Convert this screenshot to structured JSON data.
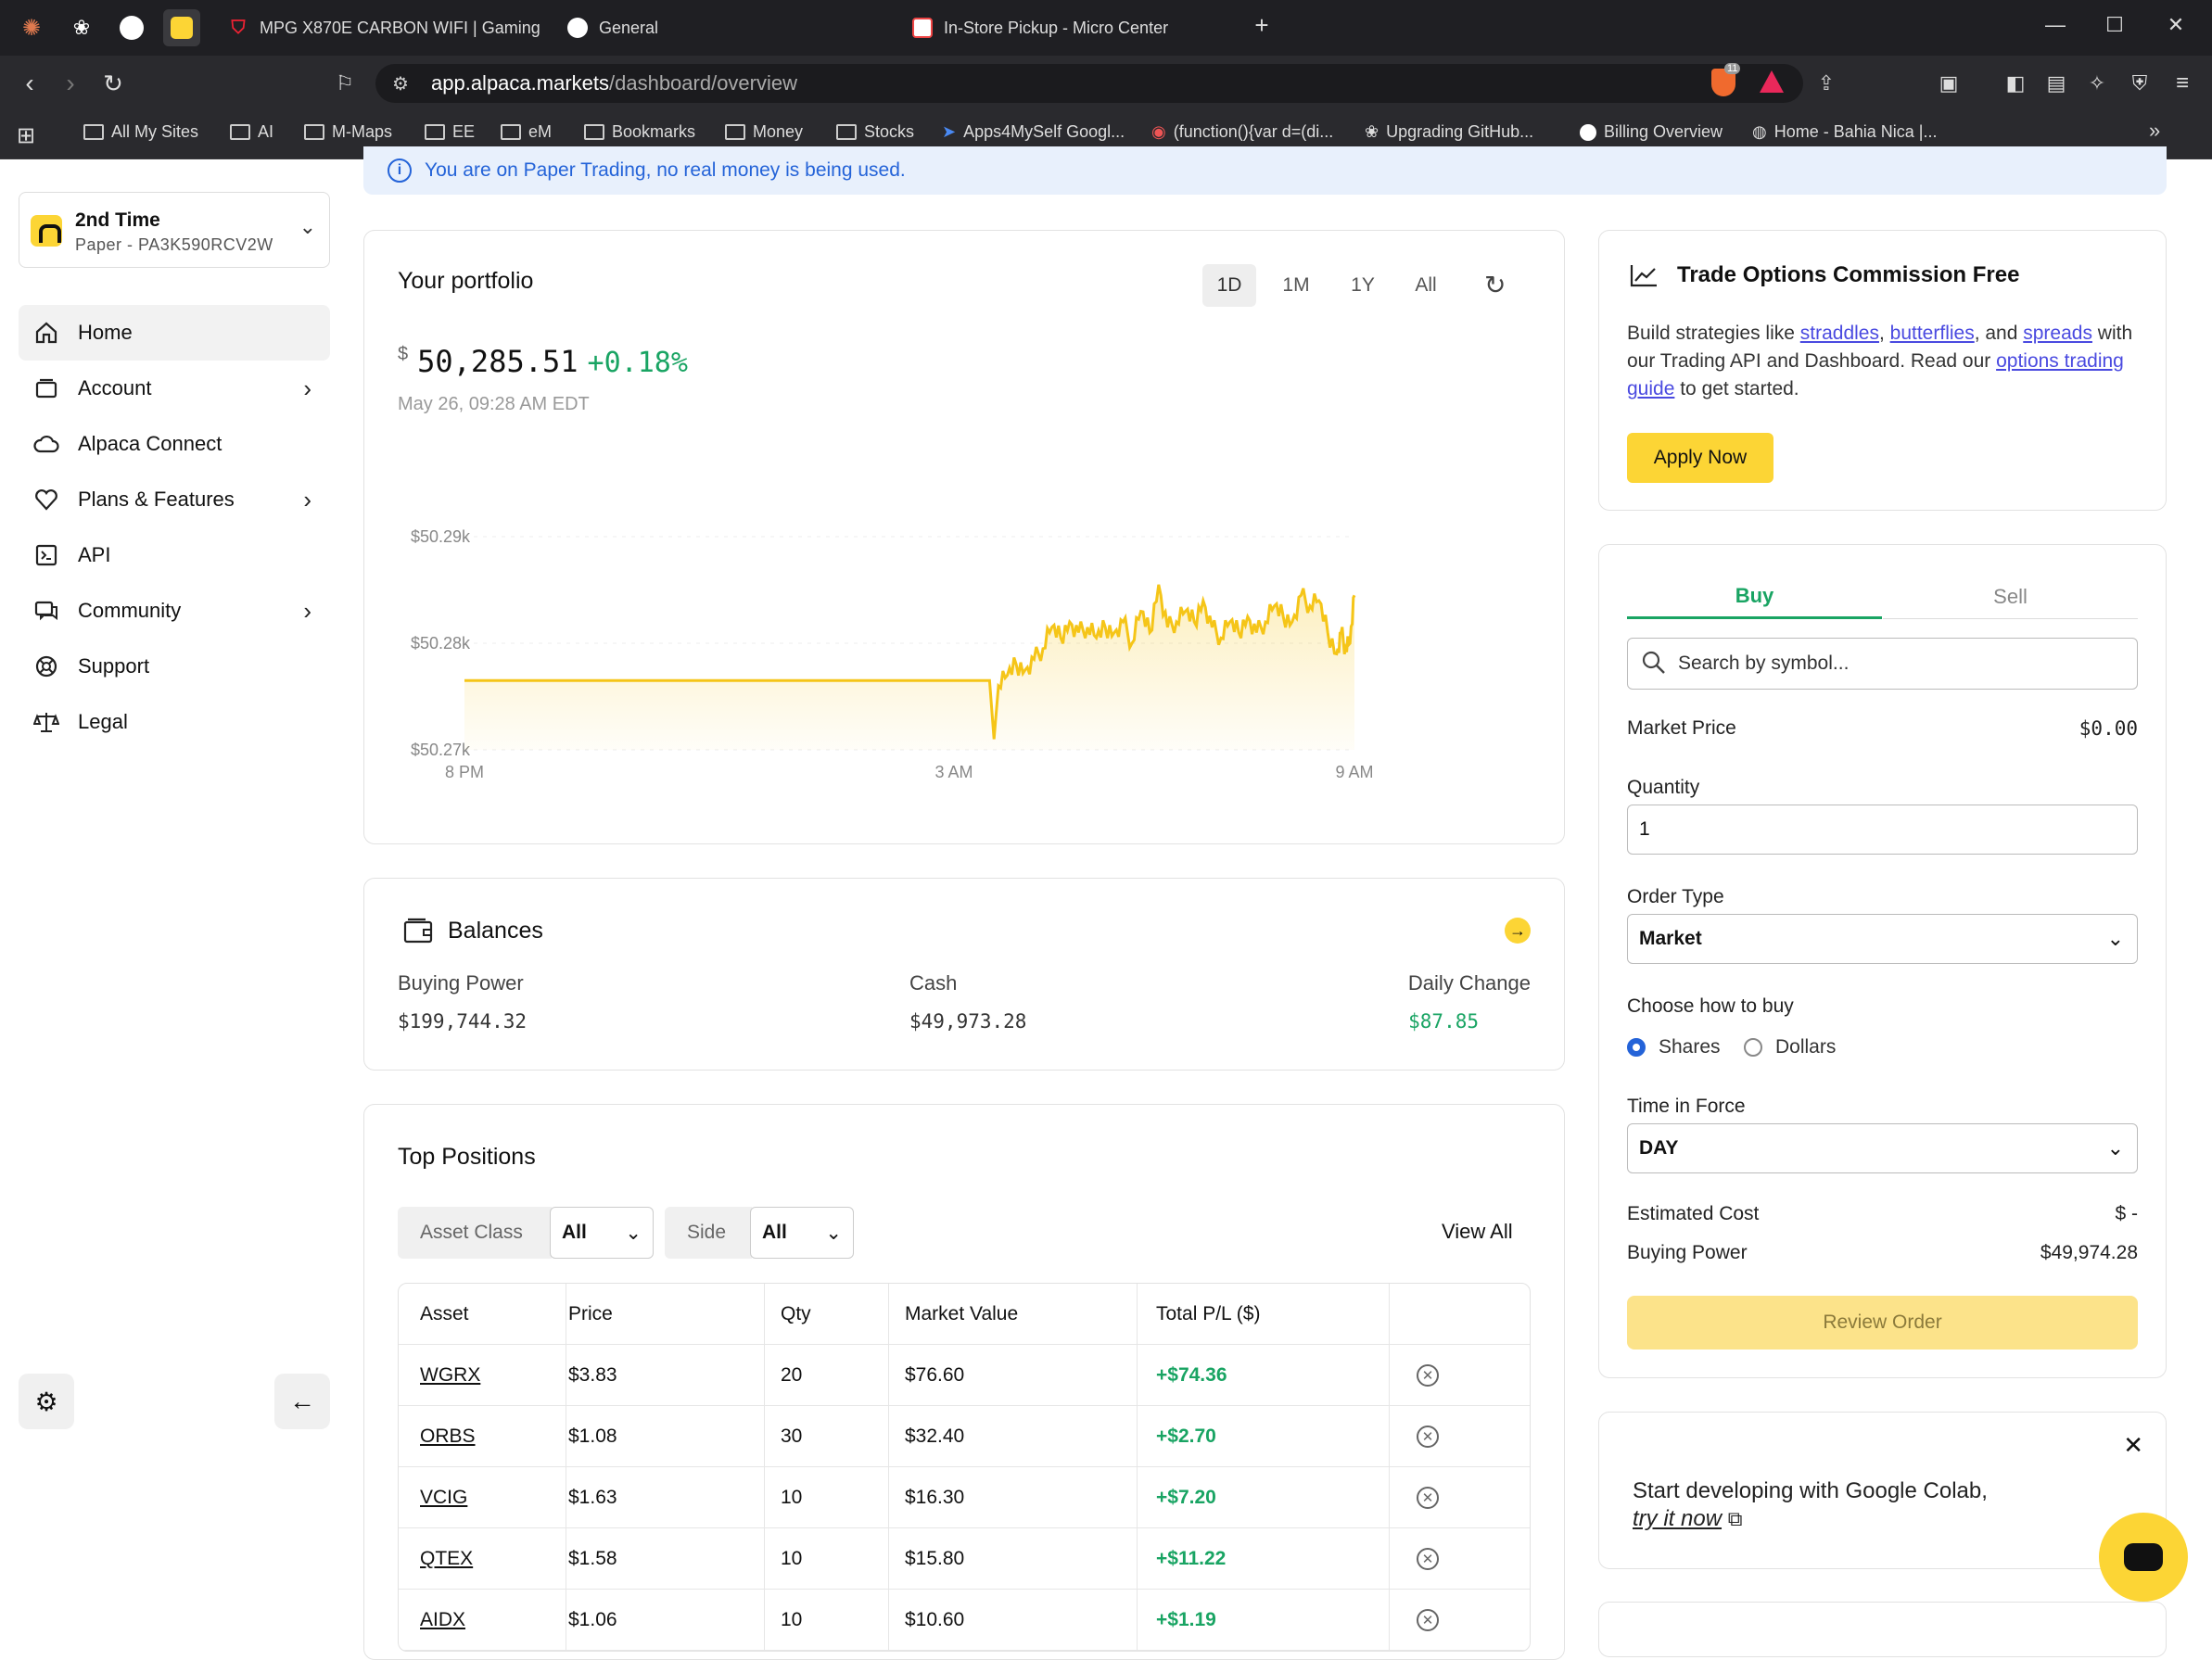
{
  "browser": {
    "tabs": [
      {
        "label": "MPG X870E CARBON WIFI | Gaming"
      },
      {
        "label": "General"
      },
      {
        "label": "In-Store Pickup - Micro Center"
      }
    ],
    "new_tab": "+",
    "url_host": "app.alpaca.markets",
    "url_path": "/dashboard/overview",
    "brave_badge": "11",
    "bookmarks": [
      "All My Sites",
      "AI",
      "M-Maps",
      "EE",
      "eM",
      "Bookmarks",
      "Money",
      "Stocks",
      "Apps4MySelf Googl...",
      "(function(){var d=(di...",
      "Upgrading GitHub...",
      "Billing Overview",
      "Home - Bahia Nica |..."
    ],
    "more": "»"
  },
  "banner": "You are on Paper Trading, no real money is being used.",
  "account": {
    "name": "2nd Time",
    "sub": "Paper - PA3K590RCV2W"
  },
  "nav": [
    {
      "label": "Home"
    },
    {
      "label": "Account"
    },
    {
      "label": "Alpaca Connect"
    },
    {
      "label": "Plans & Features"
    },
    {
      "label": "API"
    },
    {
      "label": "Community"
    },
    {
      "label": "Support"
    },
    {
      "label": "Legal"
    }
  ],
  "portfolio": {
    "title": "Your portfolio",
    "ranges": [
      "1D",
      "1M",
      "1Y",
      "All"
    ],
    "currency": "$",
    "value": "50,285.51",
    "change": "+0.18%",
    "date": "May 26, 09:28 AM EDT"
  },
  "chart_data": {
    "type": "area",
    "yticks": [
      "$50.29k",
      "$50.28k",
      "$50.27k"
    ],
    "xticks": [
      "8 PM",
      "3 AM",
      "9 AM"
    ],
    "ylim": [
      50270,
      50290
    ],
    "color": "#f5c518",
    "x": [
      0,
      1,
      2,
      3,
      4,
      5,
      6,
      7,
      8,
      9,
      10,
      11,
      12,
      13,
      14,
      15,
      16,
      17,
      18,
      19,
      20,
      21,
      22,
      23,
      24,
      25,
      26,
      27,
      28,
      29,
      30,
      31,
      32,
      33,
      34,
      35,
      36,
      37,
      38,
      39,
      40,
      41,
      42,
      43,
      44,
      45,
      46,
      47,
      48,
      49,
      50,
      51,
      52,
      53,
      54,
      55,
      56,
      57,
      58,
      59,
      60,
      61,
      62,
      63,
      64,
      65,
      66,
      67,
      68,
      69,
      70,
      71,
      72,
      73,
      74,
      75,
      76,
      77,
      78,
      79,
      80,
      81,
      82,
      83,
      84,
      85,
      86,
      87,
      88,
      89,
      90,
      91,
      92,
      93,
      94,
      95,
      96,
      97,
      98,
      99,
      100
    ],
    "y": [
      50276.0,
      50276.5,
      50276.5,
      50276.5,
      50276.5,
      50276.5,
      50276.5,
      50276.5,
      50276.5,
      50276.5,
      50276.5,
      50276.5,
      50276.5,
      50276.5,
      50276.5,
      50276.5,
      50276.5,
      50276.5,
      50276.5,
      50276.5,
      50276.5,
      50276.5,
      50276.5,
      50276.5,
      50276.5,
      50276.5,
      50276.5,
      50276.5,
      50276.5,
      50276.5,
      50276.5,
      50276.5,
      50276.5,
      50276.5,
      50276.5,
      50276.5,
      50276.5,
      50276.5,
      50276.5,
      50276.5,
      50276.5,
      50276.5,
      50276.5,
      50276.5,
      50276.5,
      50276.5,
      50276.5,
      50276.5,
      50276.5,
      50276.5,
      50276.5,
      50276.5,
      50276.5,
      50276.5,
      50276.5,
      50276.5,
      50276.5,
      50276.5,
      50276.5,
      50276.5,
      50276.5,
      50276.5,
      50276.5,
      50276.5,
      50276.5,
      50276.5,
      50276.5,
      50276.5,
      50276.5,
      50276.5,
      50276.5,
      50276.5,
      50276.5,
      50276.5,
      50276.5,
      50276.5,
      50276.5,
      50276.5,
      50276.5,
      50276.5,
      50276.5,
      50276.5,
      50276.5,
      50276.5,
      50276.5,
      50276.5,
      50276.5,
      50276.5,
      50276.5,
      50276.5,
      50276.5,
      50276.5,
      50276.5,
      50276.5,
      50276.5,
      50276.5,
      50276.5,
      50276.5,
      50276.5,
      50276.5,
      50276.5
    ]
  },
  "chart_series": {
    "x": [
      0,
      5,
      10,
      20,
      30,
      40,
      50,
      59.0,
      59.5,
      60,
      61,
      62,
      63,
      64,
      65,
      66,
      67,
      68,
      69,
      70,
      71,
      72,
      73,
      74,
      75,
      76,
      77,
      78,
      79,
      80,
      81,
      82,
      83,
      84,
      85,
      86,
      87,
      88,
      89,
      90,
      91,
      92,
      93,
      94,
      95,
      96,
      97,
      98,
      98.5,
      99,
      99.5,
      100
    ],
    "y": [
      50276.5,
      50276.5,
      50276.5,
      50276.5,
      50276.5,
      50276.5,
      50276.5,
      50276.5,
      50271.0,
      50276.0,
      50277.0,
      50278.0,
      50277.5,
      50278.5,
      50279.5,
      50281.5,
      50280.5,
      50282.0,
      50281.0,
      50281.5,
      50280.5,
      50281.5,
      50281.0,
      50282.0,
      50280.0,
      50283.0,
      50281.0,
      50285.5,
      50281.5,
      50282.0,
      50283.0,
      50282.0,
      50284.0,
      50281.5,
      50280.5,
      50282.0,
      50281.0,
      50282.5,
      50281.0,
      50282.0,
      50283.5,
      50282.5,
      50282.0,
      50284.5,
      50283.5,
      50284.0,
      50281.0,
      50279.0,
      50281.0,
      50279.5,
      50280.0,
      50284.5
    ]
  },
  "balances": {
    "title": "Balances",
    "buying_power_label": "Buying Power",
    "buying_power": "$199,744.32",
    "cash_label": "Cash",
    "cash": "$49,973.28",
    "daily_change_label": "Daily Change",
    "daily_change": "$87.85"
  },
  "positions": {
    "title": "Top Positions",
    "filter_asset_label": "Asset Class",
    "filter_asset_value": "All",
    "filter_side_label": "Side",
    "filter_side_value": "All",
    "view_all": "View All",
    "columns": [
      "Asset",
      "Price",
      "Qty",
      "Market Value",
      "Total P/L ($)"
    ],
    "rows": [
      {
        "asset": "WGRX",
        "price": "$3.83",
        "qty": "20",
        "mv": "$76.60",
        "pl": "+$74.36"
      },
      {
        "asset": "ORBS",
        "price": "$1.08",
        "qty": "30",
        "mv": "$32.40",
        "pl": "+$2.70"
      },
      {
        "asset": "VCIG",
        "price": "$1.63",
        "qty": "10",
        "mv": "$16.30",
        "pl": "+$7.20"
      },
      {
        "asset": "QTEX",
        "price": "$1.58",
        "qty": "10",
        "mv": "$15.80",
        "pl": "+$11.22"
      },
      {
        "asset": "AIDX",
        "price": "$1.06",
        "qty": "10",
        "mv": "$10.60",
        "pl": "+$1.19"
      }
    ]
  },
  "promo": {
    "title": "Trade Options Commission Free",
    "t1": "Build strategies like ",
    "l1": "straddles",
    "t2": ", ",
    "l2": "butterflies",
    "t3": ", and ",
    "l3": "spreads",
    "t4": " with our Trading API and Dashboard. Read our ",
    "l4": "options trading guide",
    "t5": " to get started.",
    "button": "Apply Now"
  },
  "order": {
    "buy_tab": "Buy",
    "sell_tab": "Sell",
    "search_placeholder": "Search by symbol...",
    "market_price_label": "Market Price",
    "market_price": "$0.00",
    "quantity_label": "Quantity",
    "quantity": "1",
    "order_type_label": "Order Type",
    "order_type": "Market",
    "how_label": "Choose how to buy",
    "opt_shares": "Shares",
    "opt_dollars": "Dollars",
    "tif_label": "Time in Force",
    "tif": "DAY",
    "est_cost_label": "Estimated Cost",
    "est_cost": "$ -",
    "bp_label": "Buying Power",
    "bp": "$49,974.28",
    "review": "Review Order"
  },
  "colab": {
    "text": "Start developing with Google Colab,",
    "link": "try it now"
  }
}
